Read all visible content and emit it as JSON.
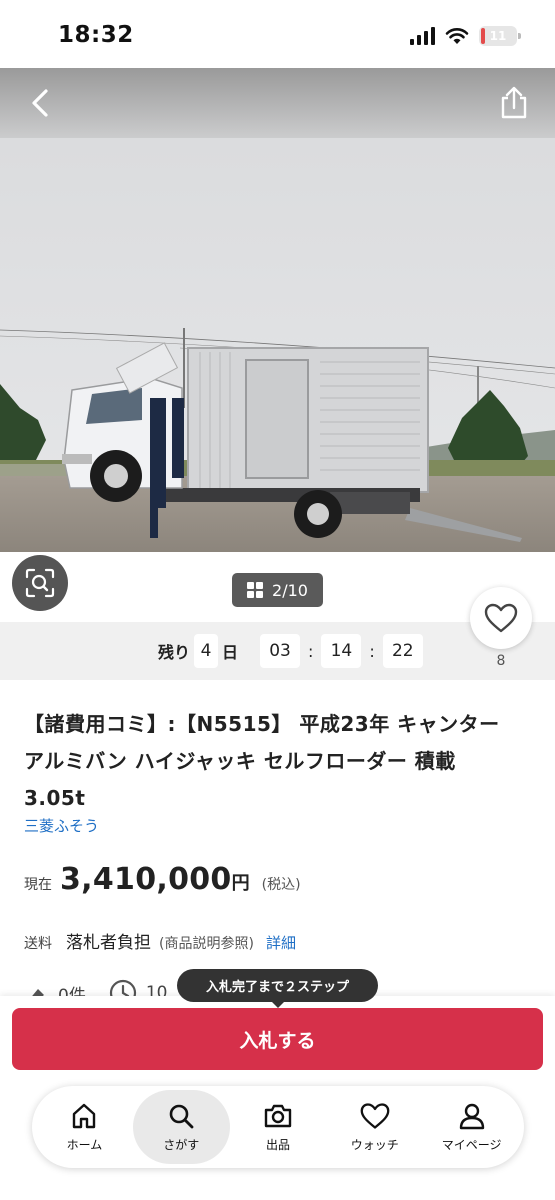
{
  "status": {
    "time": "18:32",
    "battery": "11",
    "battery_level": 0.11
  },
  "gallery": {
    "counter": "2/10"
  },
  "timer": {
    "remaining_label": "残り",
    "days": "4",
    "day_unit": "日",
    "hours": "03",
    "minutes": "14",
    "seconds": "22",
    "sep": ":"
  },
  "watch": {
    "count": "8"
  },
  "item": {
    "title": "【諸費用コミ】:【N5515】 平成23年 キャンター アルミバン ハイジャッキ セルフローダー 積載3.05t",
    "maker": "三菱ふそう",
    "price_label": "現在",
    "price": "3,410,000",
    "price_unit": "円",
    "tax": "(税込)",
    "shipping_label": "送料",
    "shipping_value": "落札者負担",
    "shipping_note": "(商品説明参照)",
    "shipping_link": "詳細",
    "bids_partial": "0件",
    "time_partial": "10"
  },
  "tooltip": {
    "text": "入札完了まで２ステップ"
  },
  "bid_button": {
    "label": "入札する"
  },
  "nav": {
    "items": [
      {
        "label": "ホーム",
        "icon": "home-icon"
      },
      {
        "label": "さがす",
        "icon": "search-icon"
      },
      {
        "label": "出品",
        "icon": "camera-icon"
      },
      {
        "label": "ウォッチ",
        "icon": "heart-icon"
      },
      {
        "label": "マイページ",
        "icon": "person-icon"
      }
    ]
  },
  "colors": {
    "accent": "#d6304a",
    "link": "#1f6fc5",
    "tooltip": "#333333"
  }
}
